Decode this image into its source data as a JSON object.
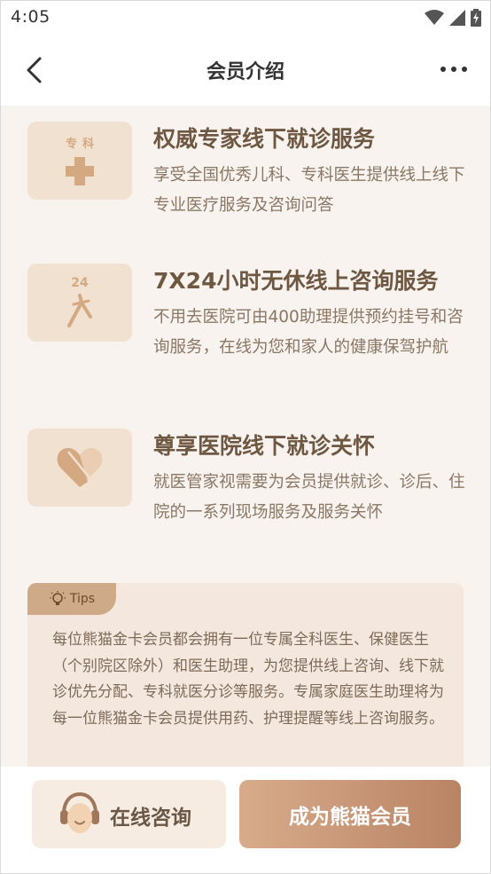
{
  "status_bar": {
    "time": "4:05"
  },
  "header": {
    "title": "会员介绍"
  },
  "services": [
    {
      "icon_name": "plus-cross-icon",
      "icon_label": "专科",
      "title": "权威专家线下就诊服务",
      "description": "享受全国优秀儿科、专科医生提供线上线下专业医疗服务及咨询问答"
    },
    {
      "icon_name": "stethoscope-icon",
      "icon_label": "24",
      "title": "7X24小时无休线上咨询服务",
      "description": "不用去医院可由400助理提供预约挂号和咨询服务，在线为您和家人的健康保驾护航"
    },
    {
      "icon_name": "heart-icon",
      "title": "尊享医院线下就诊关怀",
      "description": "就医管家视需要为会员提供就诊、诊后、住院的一系列现场服务及服务关怀"
    }
  ],
  "tips": {
    "label": "Tips",
    "text": "每位熊猫金卡会员都会拥有一位专属全科医生、保健医生（个别院区除外）和医生助理，为您提供线上咨询、线下就诊优先分配、专科就医分诊等服务。专属家庭医生助理将为每一位熊猫金卡会员提供用药、护理提醒等线上咨询服务。"
  },
  "bottom": {
    "consult_label": "在线咨询",
    "member_label": "成为熊猫会员"
  },
  "colors": {
    "accent": "#c8957a",
    "title_brown": "#6f5842",
    "icon_bg": "#f1e1d1",
    "content_bg": "#f8f3ee"
  }
}
